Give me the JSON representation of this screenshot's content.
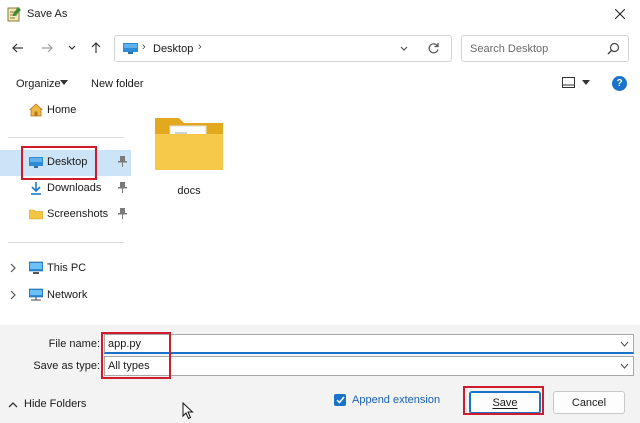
{
  "window": {
    "title": "Save As"
  },
  "navigation": {
    "back": "back",
    "forward": "forward",
    "recent": "recent-locations",
    "up": "up"
  },
  "address": {
    "location": "Desktop",
    "separator": "›"
  },
  "search": {
    "placeholder": "Search Desktop"
  },
  "toolbar": {
    "organize_label": "Organize",
    "new_folder_label": "New folder",
    "help_label": "?"
  },
  "sidebar": {
    "items": [
      {
        "label": "Home",
        "icon": "home-icon"
      },
      {
        "label": "Desktop",
        "icon": "desktop-icon",
        "selected": true
      },
      {
        "label": "Downloads",
        "icon": "download-icon"
      },
      {
        "label": "Screenshots",
        "icon": "folder-icon"
      },
      {
        "label": "This PC",
        "icon": "computer-icon"
      },
      {
        "label": "Network",
        "icon": "network-icon"
      }
    ]
  },
  "content": {
    "items": [
      {
        "name": "docs",
        "type": "folder"
      }
    ]
  },
  "form": {
    "file_name_label": "File name:",
    "file_name_value": "app.py",
    "save_type_label": "Save as type:",
    "save_type_value": "All types"
  },
  "footer": {
    "hide_folders_label": "Hide Folders",
    "append_extension_label": "Append extension",
    "append_extension_checked": true,
    "save_label": "Save",
    "cancel_label": "Cancel"
  },
  "colors": {
    "accent": "#1a73c9",
    "highlight_border": "#cf1b2b",
    "selection_bg": "#cce4f7",
    "folder": "#f4c542"
  }
}
